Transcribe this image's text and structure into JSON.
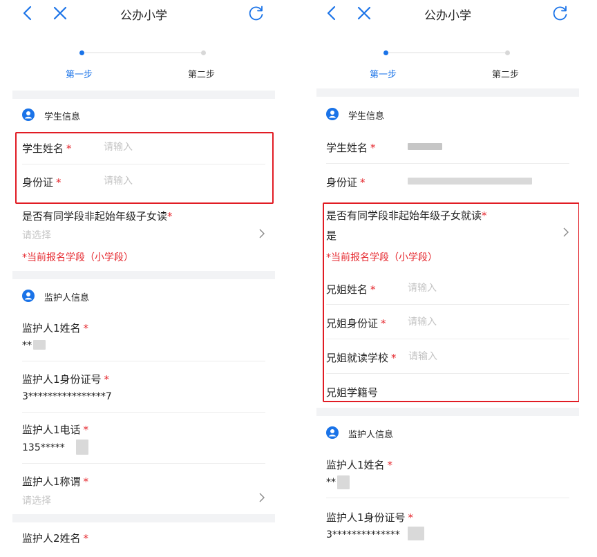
{
  "colors": {
    "accent": "#1a73e8",
    "required": "#e5262c",
    "highlight_box": "#e11c24"
  },
  "icons": {
    "back": "chevron-left-icon",
    "close": "close-icon",
    "refresh": "refresh-icon",
    "section": "user-circle-icon",
    "select": "chevron-right-icon"
  },
  "screens": {
    "left": {
      "title": "公办小学",
      "steps": [
        "第一步",
        "第二步"
      ],
      "student_section": "学生信息",
      "name_label": "学生姓名",
      "id_label": "身份证",
      "placeholder_input": "请输入",
      "sibling_question": "是否有同学段非起始年级子女读",
      "sibling_placeholder": "请选择",
      "stage_note": "*当前报名学段（小学段）",
      "guardian_section": "监护人信息",
      "g1_name_label": "监护人1姓名",
      "g1_name_value": "**",
      "g1_id_label": "监护人1身份证号",
      "g1_id_value": "3****************7",
      "g1_phone_label": "监护人1电话",
      "g1_phone_value": "135*****",
      "g1_title_label": "监护人1称谓",
      "g1_title_placeholder": "请选择",
      "g2_name_label": "监护人2姓名",
      "required_mark": "*"
    },
    "right": {
      "title": "公办小学",
      "steps": [
        "第一步",
        "第二步"
      ],
      "student_section": "学生信息",
      "name_label": "学生姓名",
      "id_label": "身份证",
      "sibling_question": "是否有同学段非起始年级子女就读",
      "sibling_value": "是",
      "stage_note": "*当前报名学段（小学段）",
      "sib_name_label": "兄姐姓名",
      "sib_id_label": "兄姐身份证",
      "sib_school_label": "兄姐就读学校",
      "sib_record_label": "兄姐学籍号",
      "placeholder_input": "请输入",
      "guardian_section": "监护人信息",
      "g1_name_label": "监护人1姓名",
      "g1_name_value": "**",
      "g1_id_label": "监护人1身份证号",
      "g1_id_value": "3**************",
      "required_mark": "*"
    }
  }
}
